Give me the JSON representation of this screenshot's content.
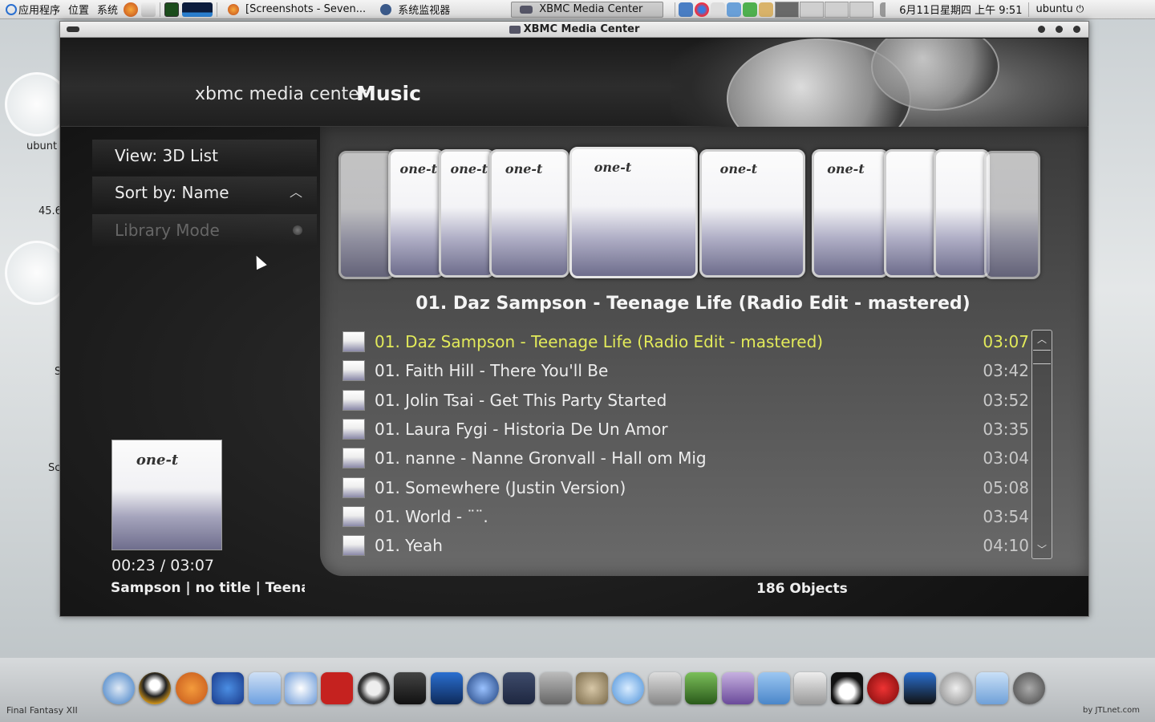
{
  "top_panel": {
    "menus": [
      "应用程序",
      "位置",
      "系统"
    ],
    "tasks": [
      {
        "label": "[Screenshots - Seven..."
      },
      {
        "label": "系统监视器"
      },
      {
        "label": "XBMC Media Center"
      }
    ],
    "clock": "6月11日星期四 上午 9:51",
    "user": "ubuntu"
  },
  "desktop": {
    "label_1": "ubunt",
    "label_2": "45.6",
    "label_3": "S",
    "label_4": "Sc"
  },
  "window": {
    "title": "XBMC Media Center"
  },
  "xbmc": {
    "brand": "xbmc media center",
    "section": "Music",
    "side_menu": {
      "view": "View: 3D List",
      "sort": "Sort by: Name",
      "library": "Library Mode"
    },
    "now_playing": {
      "time": "00:23 / 03:07",
      "info": "Sampson | no title | Teenage",
      "album_logo": "one-t"
    },
    "coverflow": {
      "caption": "01. Daz Sampson - Teenage Life (Radio Edit - mastered)",
      "album_logo": "one-t"
    },
    "songs": [
      {
        "title": "01. Daz Sampson - Teenage Life (Radio Edit - mastered)",
        "duration": "03:07",
        "selected": true
      },
      {
        "title": "01. Faith Hill - There You'll Be",
        "duration": "03:42"
      },
      {
        "title": "01. Jolin Tsai - Get This Party Started",
        "duration": "03:52"
      },
      {
        "title": "01. Laura Fygi - Historia De Un Amor",
        "duration": "03:35"
      },
      {
        "title": "01. nanne - Nanne Gronvall - Hall om Mig",
        "duration": "03:04"
      },
      {
        "title": "01. Somewhere (Justin Version)",
        "duration": "05:08"
      },
      {
        "title": "01. World - ¨¨.",
        "duration": "03:54"
      },
      {
        "title": "01. Yeah",
        "duration": "04:10"
      }
    ],
    "objects": "186 Objects"
  },
  "dock": {
    "label": "Final Fantasy XII",
    "credit": "by JTLnet.com"
  },
  "colors": {
    "selected_text": "#e2ea5a",
    "panel_bg": "#4d4d4d"
  }
}
